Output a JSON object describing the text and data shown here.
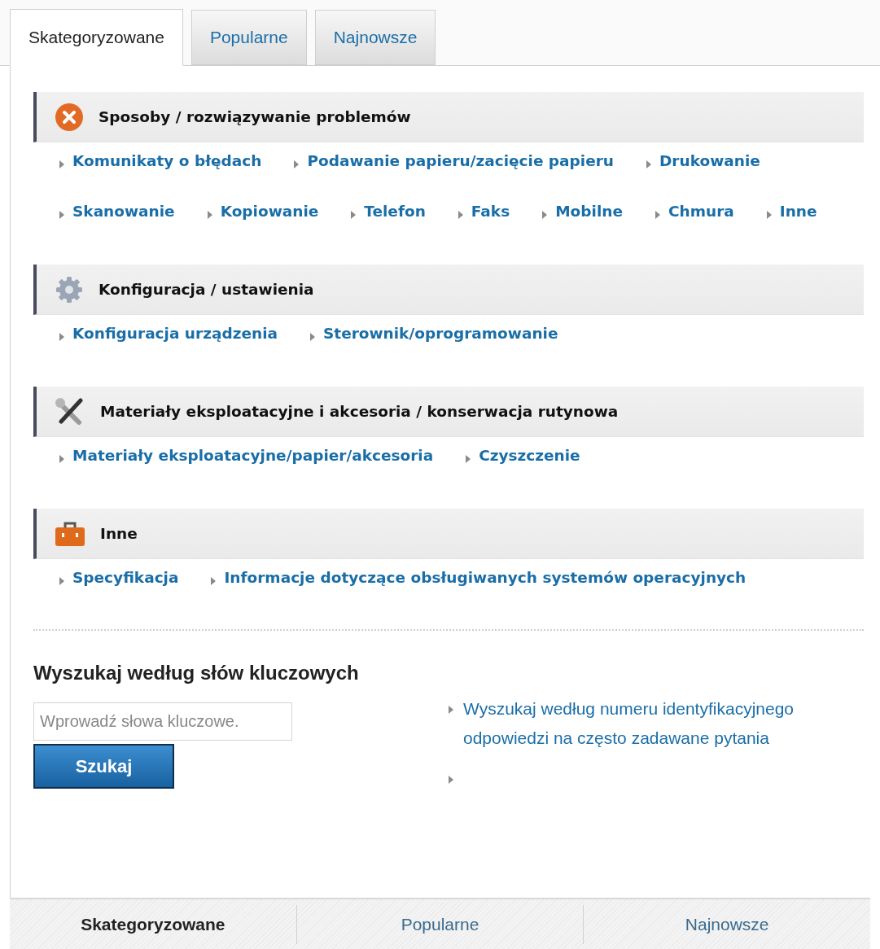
{
  "tabs": [
    {
      "label": "Skategoryzowane",
      "selected": true
    },
    {
      "label": "Popularne",
      "selected": false
    },
    {
      "label": "Najnowsze",
      "selected": false
    }
  ],
  "sections": [
    {
      "kind": "error",
      "title": "Sposoby / rozwiązywanie problemów",
      "links": [
        "Komunikaty o błędach",
        "Podawanie papieru/zacięcie papieru",
        "Drukowanie",
        "Skanowanie",
        "Kopiowanie",
        "Telefon",
        "Faks",
        "Mobilne",
        "Chmura",
        "Inne"
      ]
    },
    {
      "kind": "gear",
      "title": "Konfiguracja / ustawienia",
      "links": [
        "Konfiguracja urządzenia",
        "Sterownik/oprogramowanie"
      ]
    },
    {
      "kind": "tools",
      "title": "Materiały eksploatacyjne i akcesoria / konserwacja rutynowa",
      "links": [
        "Materiały eksploatacyjne/papier/akcesoria",
        "Czyszczenie"
      ]
    },
    {
      "kind": "toolbox",
      "title": "Inne",
      "links": [
        "Specyfikacja",
        "Informacje dotyczące obsługiwanych systemów operacyjnych"
      ]
    }
  ],
  "keyword_search": {
    "heading": "Wyszukaj według słów kluczowych",
    "placeholder": "Wprowadź słowa kluczowe.",
    "button": "Szukaj",
    "links": [
      "Wyszukaj według numeru identyfikacyjnego odpowiedzi na często zadawane pytania"
    ]
  },
  "bottom_tabs": [
    {
      "label": "Skategoryzowane",
      "selected": true
    },
    {
      "label": "Popularne",
      "selected": false
    },
    {
      "label": "Najnowsze",
      "selected": false
    }
  ]
}
